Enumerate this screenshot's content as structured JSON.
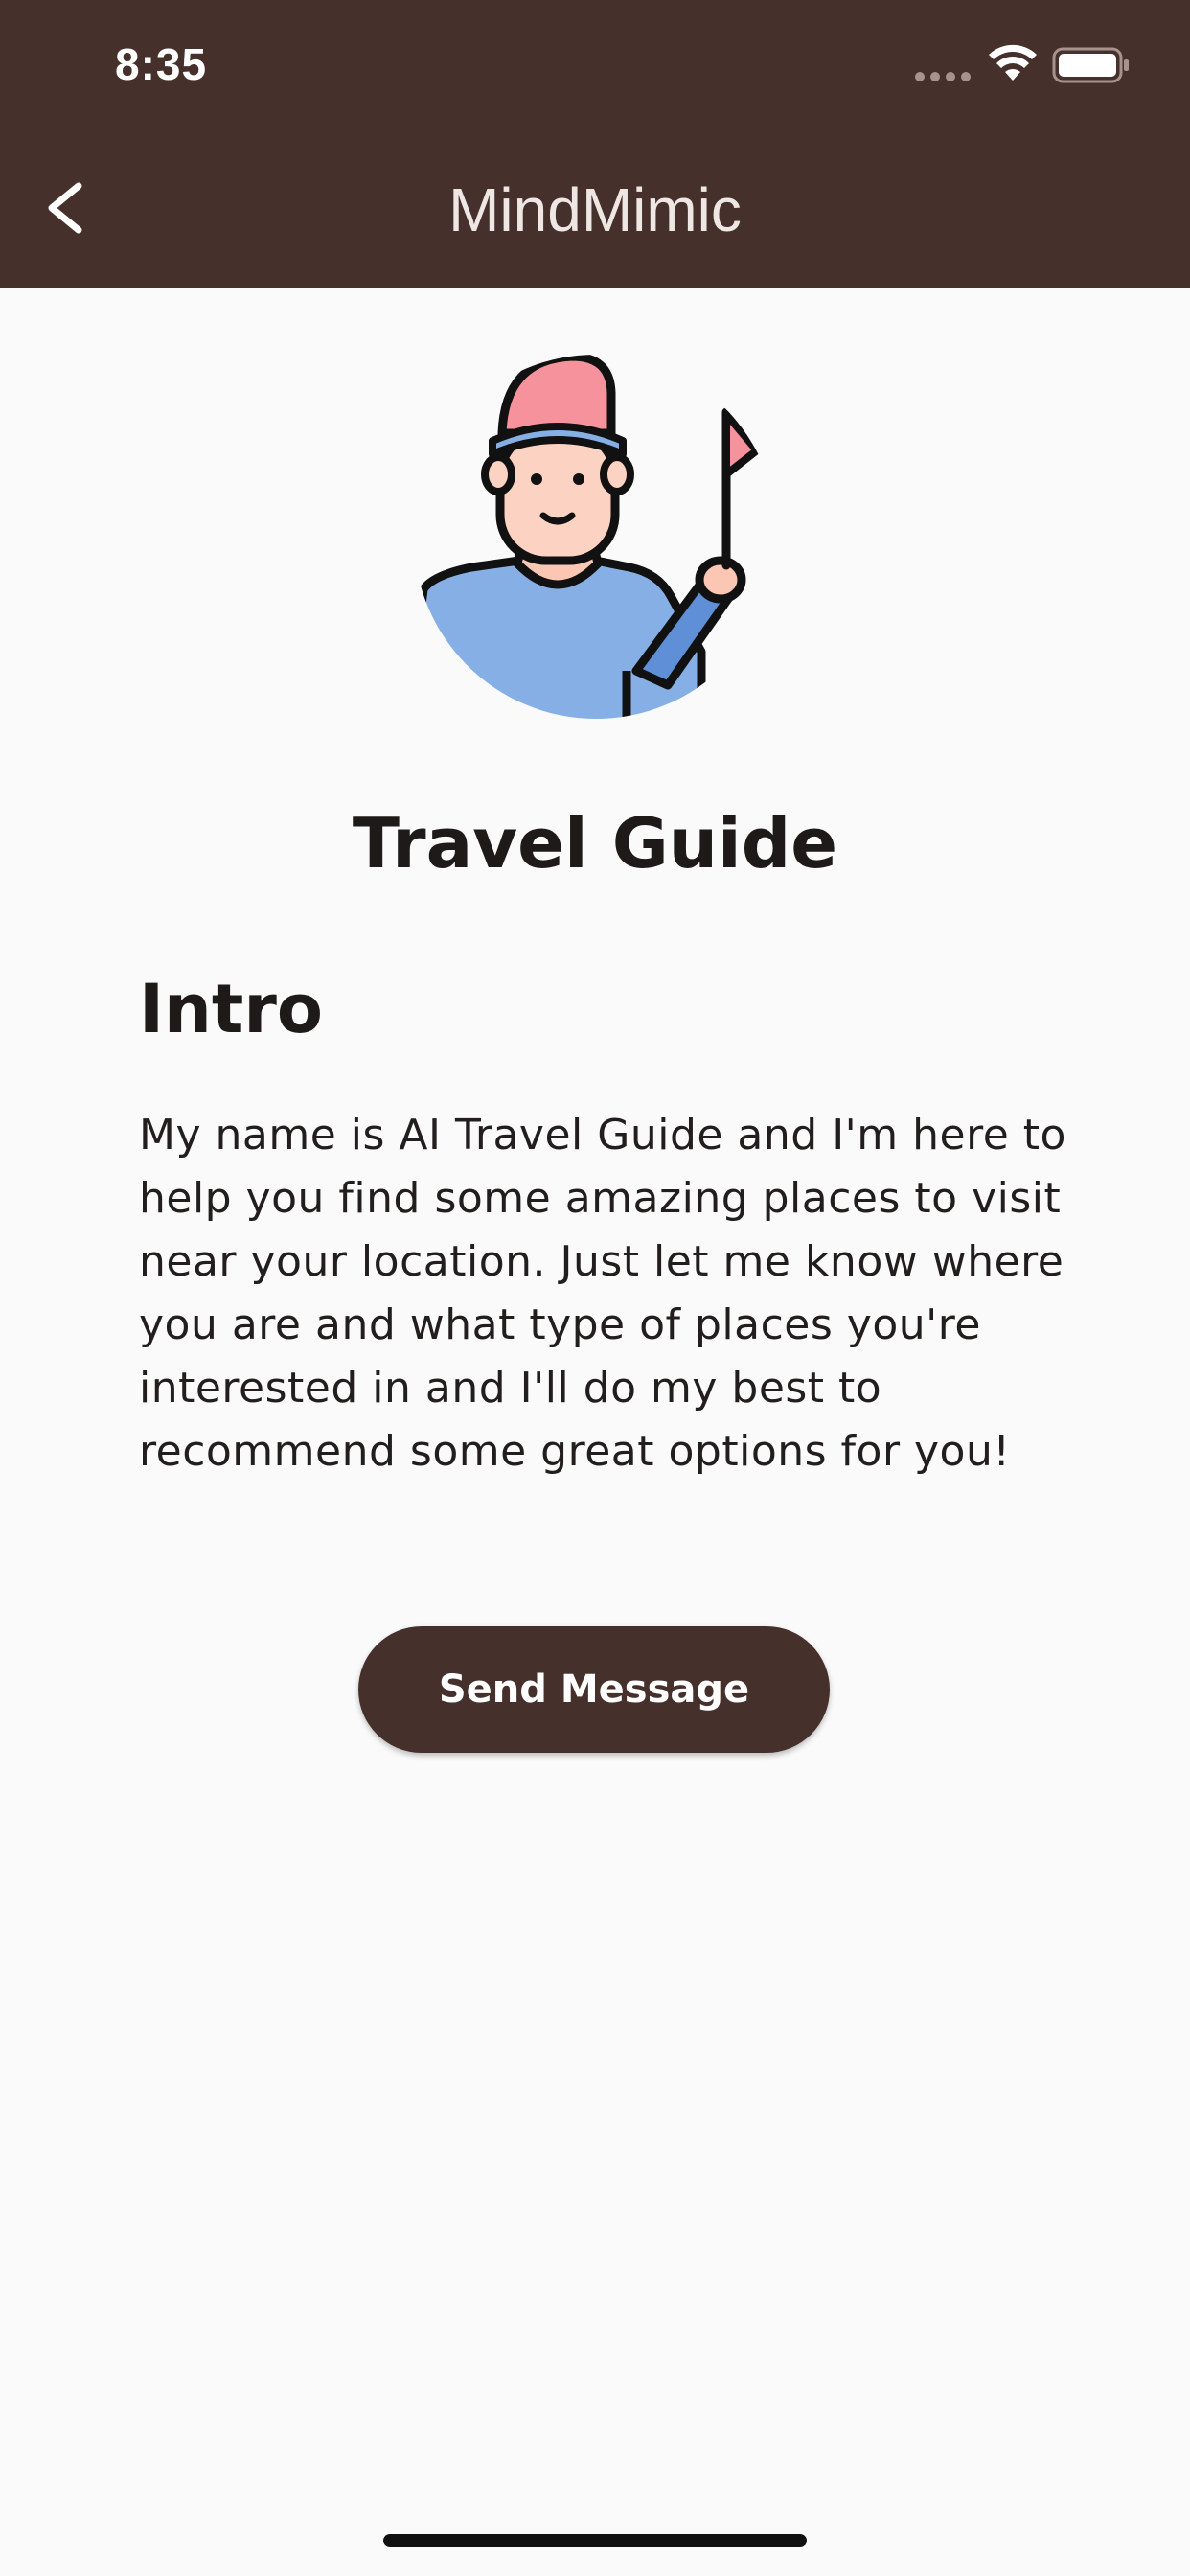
{
  "status_bar": {
    "time": "8:35",
    "wifi_icon": "wifi-icon",
    "battery_icon": "battery-icon"
  },
  "nav": {
    "title": "MindMimic",
    "back_icon": "chevron-left-icon"
  },
  "persona": {
    "avatar_icon": "travel-guide-avatar",
    "name": "Travel Guide"
  },
  "intro": {
    "heading": "Intro",
    "text": "My name is AI Travel Guide and I'm here to help you find some amazing places to visit near your location. Just let me know where you are and what type of places you're interested in and I'll do my best to recommend some great options for you!"
  },
  "actions": {
    "send_label": "Send Message"
  },
  "colors": {
    "primary": "#45302b",
    "background": "#fafafa",
    "text": "#1e1a19"
  }
}
